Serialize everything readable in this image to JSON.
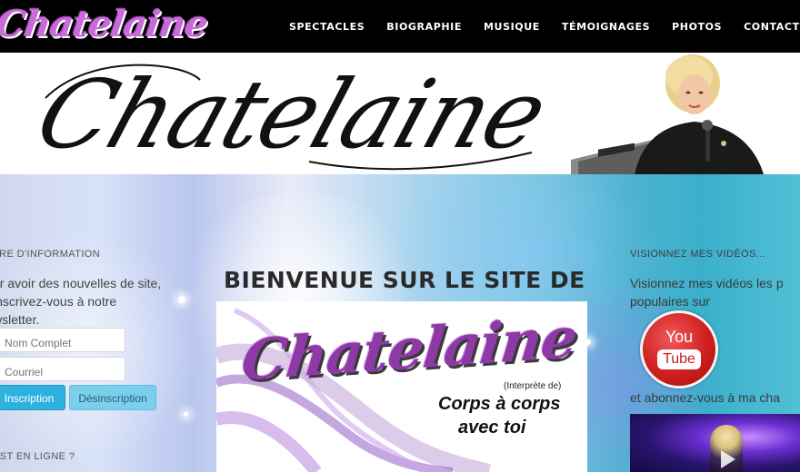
{
  "nav": {
    "logo_text": "Chatelaine",
    "items": [
      {
        "label": "SPECTACLES"
      },
      {
        "label": "BIOGRAPHIE"
      },
      {
        "label": "MUSIQUE"
      },
      {
        "label": "TÉMOIGNAGES"
      },
      {
        "label": "PHOTOS"
      },
      {
        "label": "CONTACT"
      }
    ]
  },
  "banner": {
    "script_title": "Chatelaine"
  },
  "left": {
    "heading": "TRE D'INFORMATION",
    "text": "ur avoir des nouvelles de site, inscrivez-vous à notre wsletter.",
    "name_placeholder": "Nom Complet",
    "email_placeholder": "Courriel",
    "subscribe_label": "Inscription",
    "unsubscribe_label": "Désinscription",
    "heading2": "EST EN LIGNE ?"
  },
  "center": {
    "title": "BIENVENUE SUR LE SITE DE",
    "poster_title": "Chatelaine",
    "poster_interp": "(Interprète de)",
    "poster_sub1": "Corps à corps",
    "poster_sub2": "avec toi"
  },
  "right": {
    "heading": "VISIONNEZ MES VIDÉOS...",
    "text_line1": "Visionnez mes vidéos les p",
    "text_line2": "populaires sur",
    "yt_you": "You",
    "yt_tube": "Tube",
    "text2": "et abonnez-vous à ma cha"
  },
  "colors": {
    "nav_bg": "#000000",
    "accent_blue": "#2fb1e0",
    "youtube_red": "#d01f1f",
    "logo_purple": "#c86ad8"
  },
  "icons": {
    "play": "play-icon",
    "youtube": "youtube-logo-icon"
  }
}
